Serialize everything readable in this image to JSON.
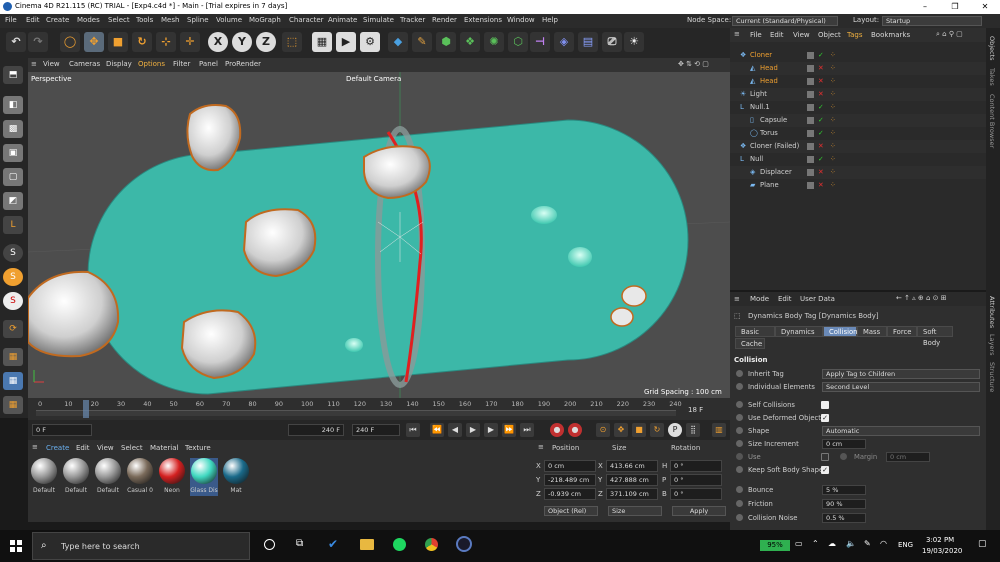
{
  "window": {
    "title": "Cinema 4D R21.115 (RC) TRIAL - [Exp4.c4d *] - Main - [Trial expires in 7 days]"
  },
  "menu": [
    "File",
    "Edit",
    "Create",
    "Modes",
    "Select",
    "Tools",
    "Mesh",
    "Spline",
    "Volume",
    "MoGraph",
    "Character",
    "Animate",
    "Simulate",
    "Tracker",
    "Render",
    "Extensions",
    "Window",
    "Help"
  ],
  "node_space": {
    "label": "Node Space:",
    "value": "Current (Standard/Physical)"
  },
  "layout": {
    "label": "Layout:",
    "value": "Startup"
  },
  "viewport_menu": [
    "View",
    "Cameras",
    "Display",
    "Options",
    "Filter",
    "Panel",
    "ProRender"
  ],
  "viewport": {
    "name": "Perspective",
    "camera": "Default Camera",
    "grid_spacing": "Grid Spacing : 100 cm"
  },
  "timeline": {
    "ticks": [
      "0",
      "10",
      "20",
      "30",
      "40",
      "50",
      "60",
      "70",
      "80",
      "90",
      "100",
      "110",
      "120",
      "130",
      "140",
      "150",
      "160",
      "170",
      "180",
      "190",
      "200",
      "210",
      "220",
      "230",
      "240"
    ],
    "current": "18 F"
  },
  "playbar": {
    "start": "0 F",
    "end_a": "240 F",
    "end_b": "240 F",
    "frame": "0 F"
  },
  "material_menu": [
    "Create",
    "Edit",
    "View",
    "Select",
    "Material",
    "Texture"
  ],
  "materials": [
    {
      "name": "Default",
      "color": "#9a9a9a"
    },
    {
      "name": "Default",
      "color": "#9a9a9a"
    },
    {
      "name": "Default",
      "color": "#9a9a9a"
    },
    {
      "name": "Casual 0",
      "color": "#7a6a5a"
    },
    {
      "name": "Neon",
      "color": "#d42020"
    },
    {
      "name": "Glass Dis",
      "color": "#3fd8c0"
    },
    {
      "name": "Mat",
      "color": "#1a6a8a"
    }
  ],
  "coords": {
    "headers": [
      "Position",
      "Size",
      "Rotation"
    ],
    "rows": [
      {
        "p_axis": "X",
        "p": "0 cm",
        "s_axis": "X",
        "s": "413.66 cm",
        "r_axis": "H",
        "r": "0 °"
      },
      {
        "p_axis": "Y",
        "p": "-218.489 cm",
        "s_axis": "Y",
        "s": "427.888 cm",
        "r_axis": "P",
        "r": "0 °"
      },
      {
        "p_axis": "Z",
        "p": "-0.939 cm",
        "s_axis": "Z",
        "s": "371.109 cm",
        "r_axis": "B",
        "r": "0 °"
      }
    ],
    "mode": "Object (Rel)",
    "size_mode": "Size",
    "apply": "Apply"
  },
  "obj_menu": [
    "File",
    "Edit",
    "View",
    "Object",
    "Tags",
    "Bookmarks"
  ],
  "objects": [
    {
      "name": "Cloner",
      "indent": 0,
      "color": "#f0a030",
      "icon": "cloner-icon",
      "x": false
    },
    {
      "name": "Head",
      "indent": 1,
      "color": "#f0a030",
      "icon": "mesh-icon",
      "x": true
    },
    {
      "name": "Head",
      "indent": 1,
      "color": "#f0a030",
      "icon": "mesh-icon",
      "x": true
    },
    {
      "name": "Light",
      "indent": 0,
      "color": "#d0d0d0",
      "icon": "light-icon",
      "x": true
    },
    {
      "name": "Null.1",
      "indent": 0,
      "color": "#d0d0d0",
      "icon": "null-icon",
      "x": false
    },
    {
      "name": "Capsule",
      "indent": 1,
      "color": "#d0d0d0",
      "icon": "capsule-icon",
      "x": false
    },
    {
      "name": "Torus",
      "indent": 1,
      "color": "#d0d0d0",
      "icon": "torus-icon",
      "x": false
    },
    {
      "name": "Cloner (Failed)",
      "indent": 0,
      "color": "#d0d0d0",
      "icon": "cloner-icon",
      "x": true
    },
    {
      "name": "Null",
      "indent": 0,
      "color": "#d0d0d0",
      "icon": "null-icon",
      "x": false
    },
    {
      "name": "Displacer",
      "indent": 1,
      "color": "#d0d0d0",
      "icon": "displacer-icon",
      "x": true
    },
    {
      "name": "Plane",
      "indent": 1,
      "color": "#d0d0d0",
      "icon": "plane-icon",
      "x": true
    }
  ],
  "attr_menu": [
    "Mode",
    "Edit",
    "User Data"
  ],
  "attr": {
    "title": "Dynamics Body Tag [Dynamics Body]",
    "tabs": [
      "Basic",
      "Dynamics",
      "Collision",
      "Mass",
      "Force",
      "Soft Body",
      "Cache"
    ],
    "active_tab": "Collision",
    "section": "Collision",
    "inherit_tag": {
      "label": "Inherit Tag",
      "value": "Apply Tag to Children"
    },
    "individual": {
      "label": "Individual Elements",
      "value": "Second Level"
    },
    "self_collisions": "Self Collisions",
    "use_deformed": "Use Deformed Object",
    "shape": {
      "label": "Shape",
      "value": "Automatic"
    },
    "size_increment": {
      "label": "Size Increment",
      "value": "0 cm"
    },
    "use": "Use",
    "margin": {
      "label": "Margin",
      "value": "0 cm"
    },
    "keep_soft": "Keep Soft Body Shape",
    "bounce": {
      "label": "Bounce",
      "value": "5 %"
    },
    "friction": {
      "label": "Friction",
      "value": "90 %"
    },
    "noise": {
      "label": "Collision Noise",
      "value": "0.5 %"
    }
  },
  "side_tabs": [
    "Objects",
    "Takes",
    "Content Browser"
  ],
  "side_tabs2": [
    "Attributes",
    "Layers",
    "Structure"
  ],
  "taskbar": {
    "search": "Type here to search",
    "battery": "95%",
    "lang": "ENG",
    "time": "3:02 PM",
    "date": "19/03/2020"
  }
}
